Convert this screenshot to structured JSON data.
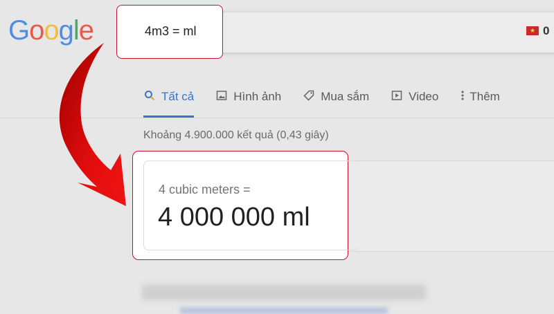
{
  "header": {
    "logo_letters": [
      "G",
      "o",
      "o",
      "g",
      "l",
      "e"
    ],
    "query": "4m3 = ml",
    "flag_icon": "vietnam-flag-icon",
    "account_count": "0"
  },
  "tabs": [
    {
      "label": "Tất cả",
      "icon": "search-icon",
      "active": true
    },
    {
      "label": "Hình ảnh",
      "icon": "image-icon",
      "active": false
    },
    {
      "label": "Mua sắm",
      "icon": "tag-icon",
      "active": false
    },
    {
      "label": "Video",
      "icon": "play-icon",
      "active": false
    },
    {
      "label": "Thêm",
      "icon": "more-vert-icon",
      "active": false
    }
  ],
  "result_stats": "Khoảng 4.900.000 kết quả (0,43 giây)",
  "answer": {
    "lead": "4 cubic meters =",
    "value": "4 000 000 ml"
  },
  "colors": {
    "highlight": "#c8102e",
    "arrow": "#e30d0d",
    "active_tab": "#3a73c9"
  }
}
